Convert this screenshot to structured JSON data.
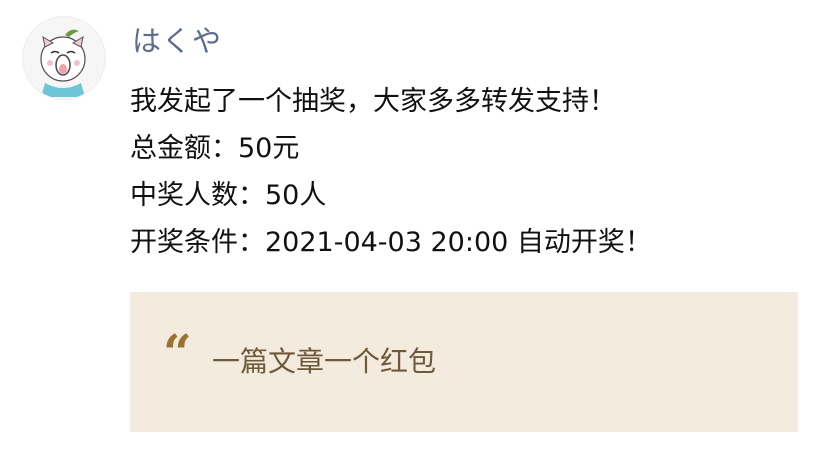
{
  "post": {
    "author": "はくや",
    "lines": [
      "我发起了一个抽奖，大家多多转发支持！",
      "总金额：50元",
      "中奖人数：50人",
      "开奖条件：2021-04-03 20:00 自动开奖！"
    ],
    "card": {
      "quote_icon": "quote-icon",
      "title": "一篇文章一个红包"
    }
  },
  "colors": {
    "author": "#5d6b8c",
    "card_bg": "#f3ebde",
    "card_text": "#6e5a3a",
    "quote": "#9a7330"
  }
}
